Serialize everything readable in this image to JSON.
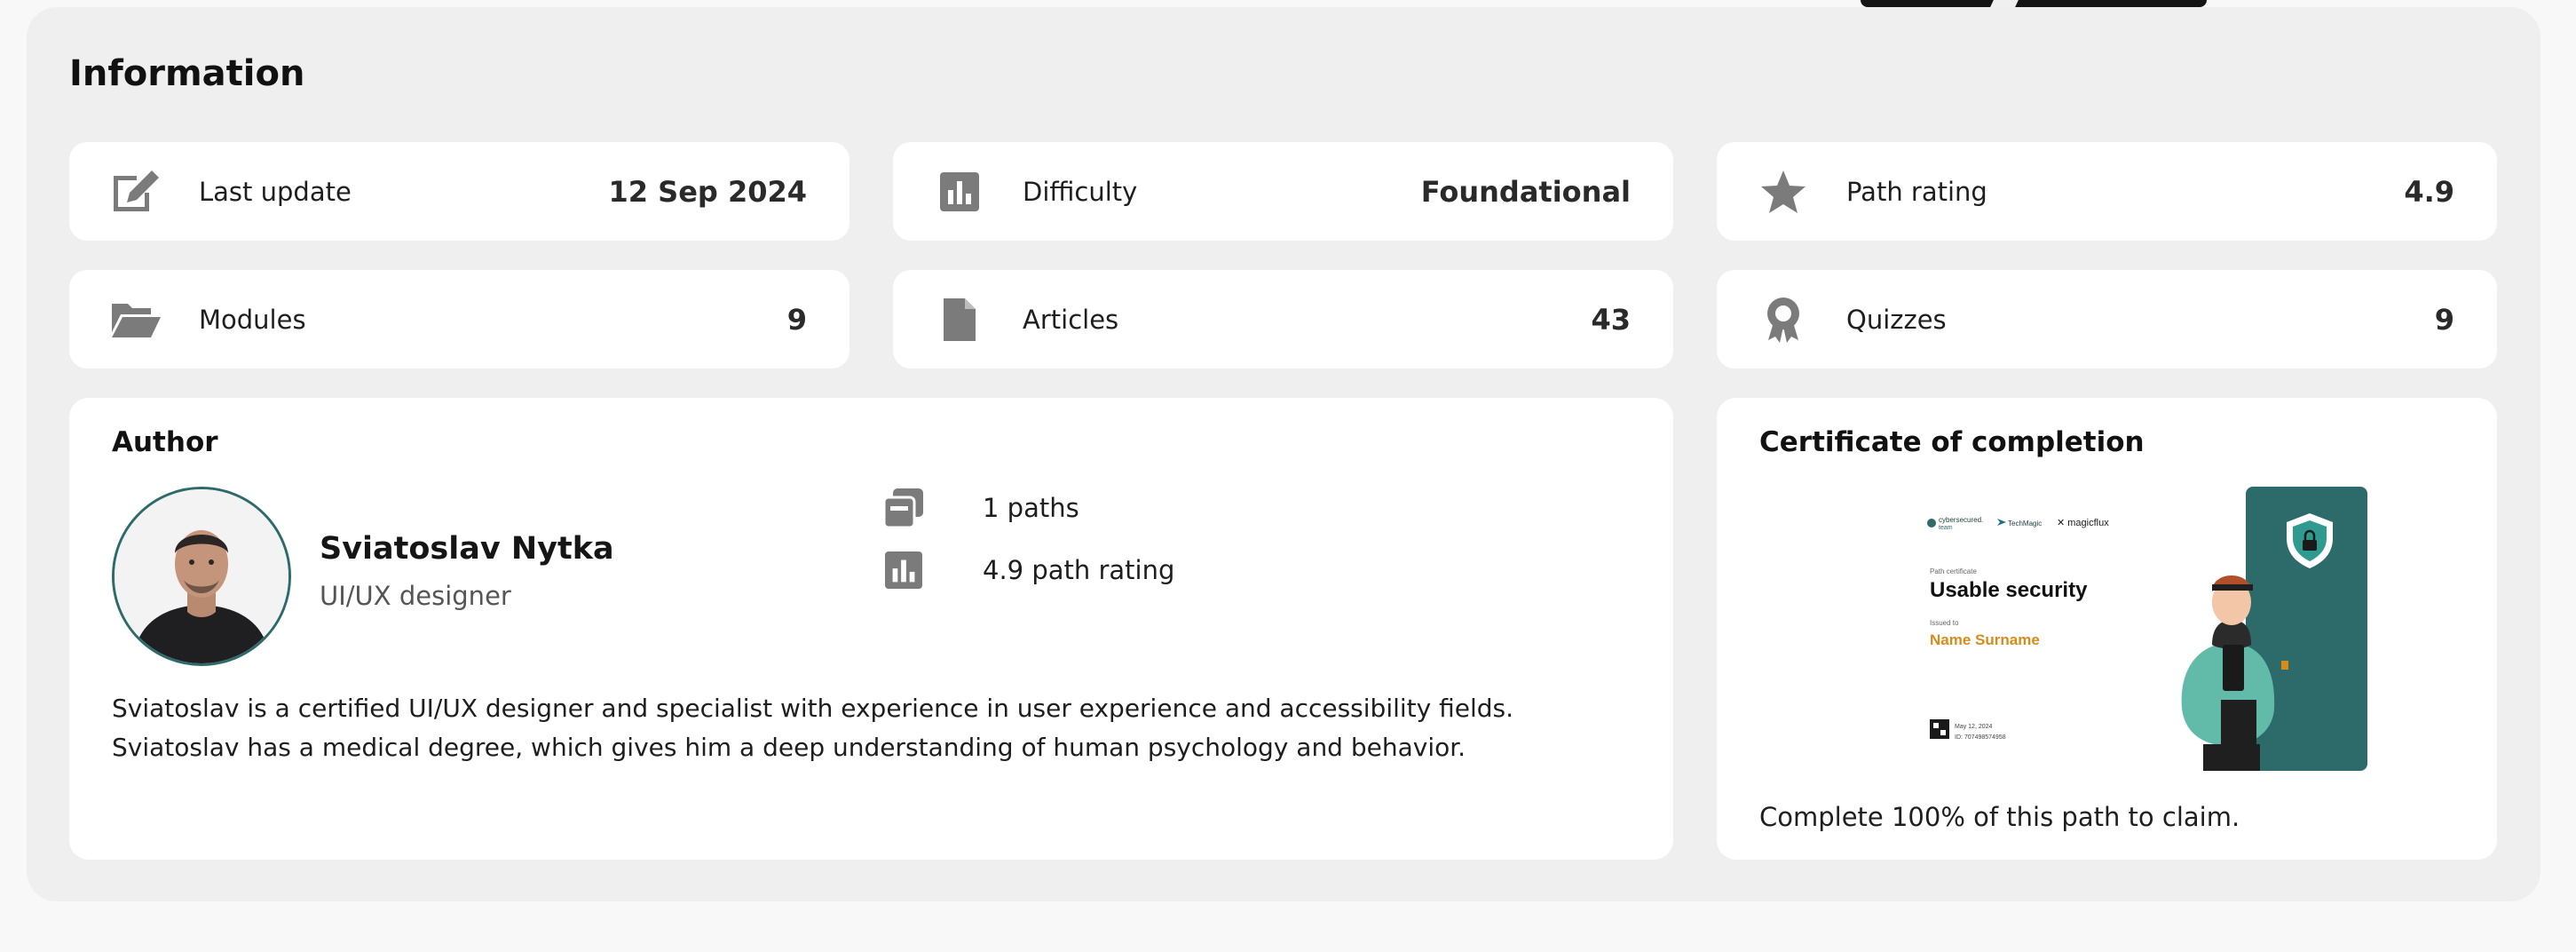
{
  "section": {
    "title": "Information"
  },
  "stats": [
    {
      "label": "Last update",
      "value": "12 Sep 2024",
      "icon": "edit-icon"
    },
    {
      "label": "Difficulty",
      "value": "Foundational",
      "icon": "bar-chart-icon"
    },
    {
      "label": "Path rating",
      "value": "4.9",
      "icon": "star-icon"
    },
    {
      "label": "Modules",
      "value": "9",
      "icon": "folder-open-icon"
    },
    {
      "label": "Articles",
      "value": "43",
      "icon": "file-icon"
    },
    {
      "label": "Quizzes",
      "value": "9",
      "icon": "award-icon"
    }
  ],
  "author": {
    "title": "Author",
    "name": "Sviatoslav Nytka",
    "role": "UI/UX designer",
    "paths": "1 paths",
    "rating": "4.9 path rating",
    "bio": "Sviatoslav is a certified UI/UX designer and specialist with experience in user experience and accessibility fields. Sviatoslav has a medical degree, which gives him a deep understanding of human psychology and behavior."
  },
  "certificate": {
    "title": "Certificate of completion",
    "caption": "Complete 100% of this path to claim.",
    "preview": {
      "logo_1": "cybersecured. team",
      "logo_2": "TechMagic",
      "logo_3": "magicflux",
      "kicker": "Path certificate",
      "heading": "Usable security",
      "issued_label": "Issued to",
      "recipient": "Name Surname",
      "date": "May 12, 2024",
      "id": "ID: 707498574958"
    }
  },
  "colors": {
    "icon_gray": "#7b7b7b",
    "teal": "#2d6a6a",
    "accent_orange": "#d88a1a"
  }
}
